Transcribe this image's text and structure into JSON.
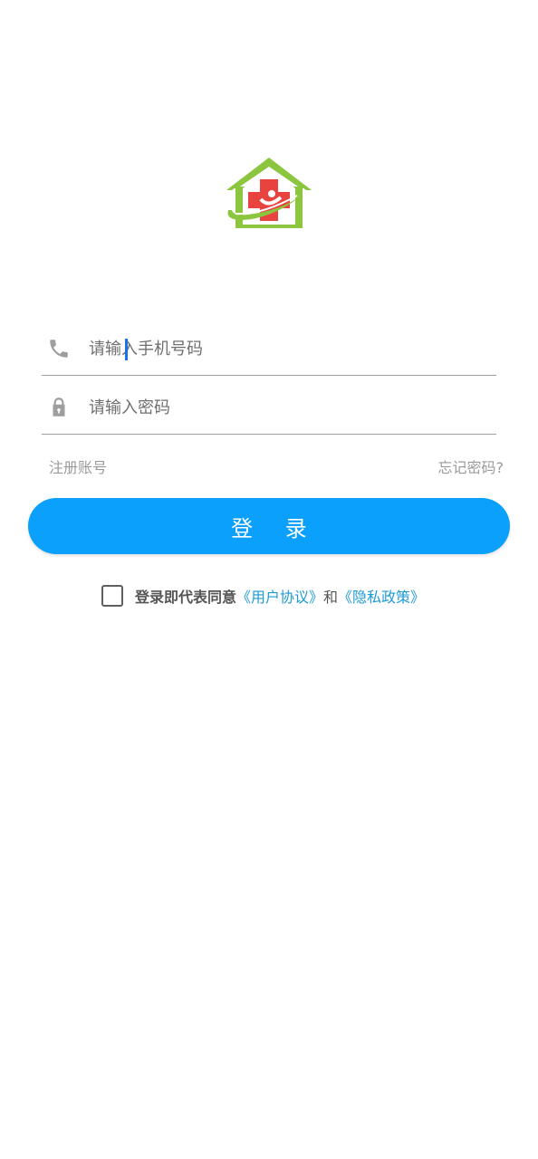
{
  "login": {
    "phone_placeholder": "请输入手机号码",
    "password_placeholder": "请输入密码",
    "register_label": "注册账号",
    "forgot_label": "忘记密码?",
    "login_button": "登 录",
    "agree_prefix": "登录即代表同意",
    "user_agreement": "《用户协议》",
    "and_text": "和",
    "privacy_policy": "《隐私政策》"
  },
  "icons": {
    "logo": "clinic-house-cross-logo",
    "phone": "phone-icon",
    "password": "lock-icon"
  },
  "colors": {
    "primary": "#0aa0fb",
    "link": "#1e9ad6",
    "logo_green": "#8cc63f",
    "logo_red": "#e8433f"
  }
}
